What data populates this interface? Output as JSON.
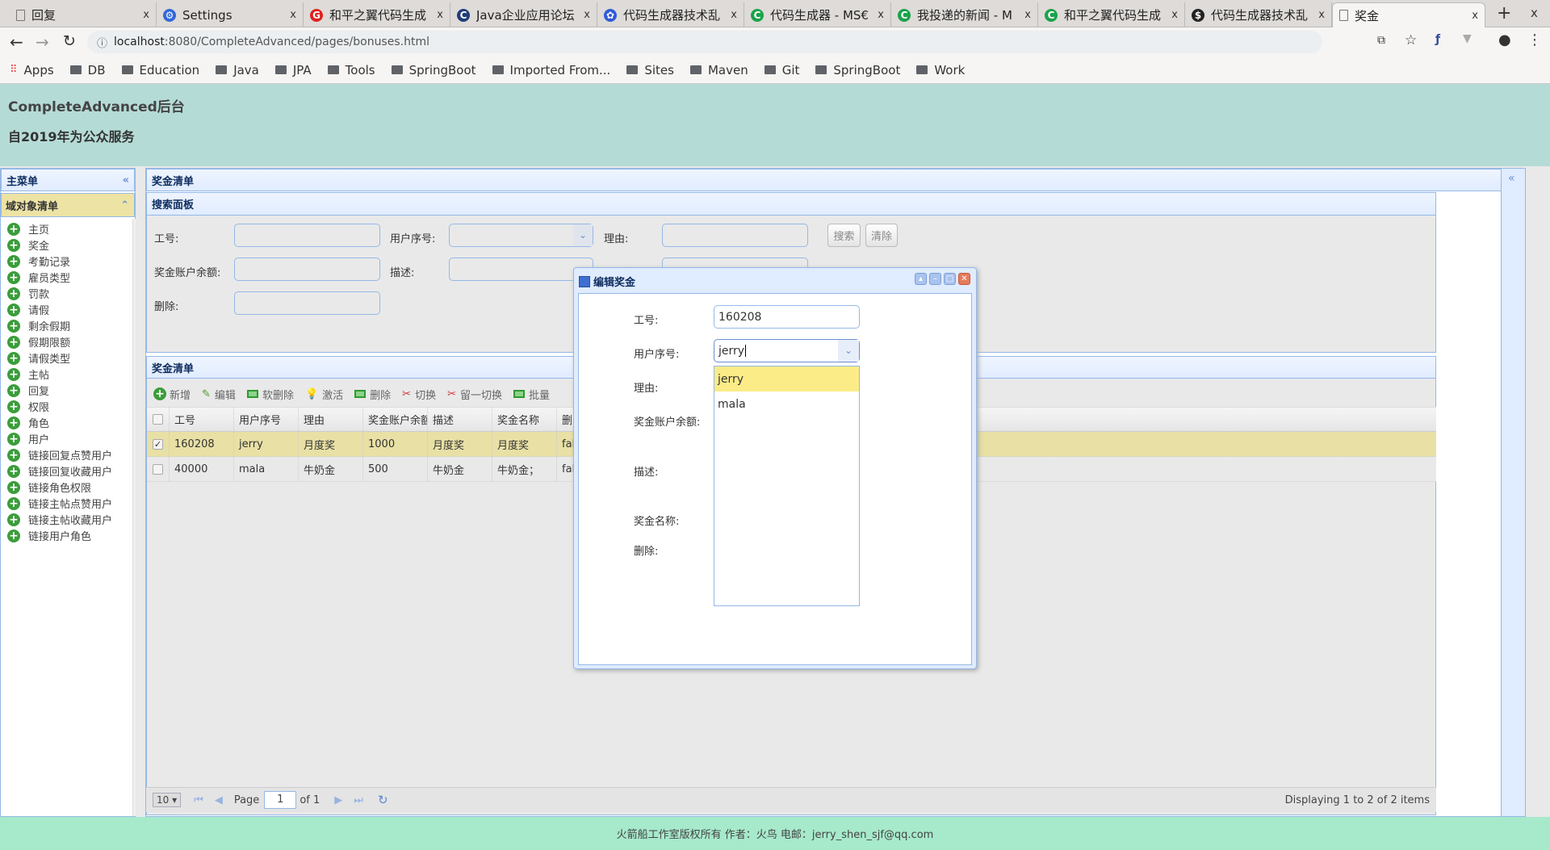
{
  "browser": {
    "tabs": [
      {
        "title": "回复",
        "icon": "page-icon",
        "color": "#555"
      },
      {
        "title": "Settings",
        "icon": "gear-icon",
        "color": "#3367d6"
      },
      {
        "title": "和平之翼代码生成",
        "icon": "g-icon",
        "color": "#e02020"
      },
      {
        "title": "Java企业应用论坛",
        "icon": "c-icon",
        "color": "#1e3d7a"
      },
      {
        "title": "代码生成器技术乱",
        "icon": "paw-icon",
        "color": "#2f5bd8"
      },
      {
        "title": "代码生成器 - MS€",
        "icon": "c-icon",
        "color": "#1aa34a"
      },
      {
        "title": "我投递的新闻 - M",
        "icon": "c-icon",
        "color": "#1aa34a"
      },
      {
        "title": "和平之翼代码生成",
        "icon": "c-icon",
        "color": "#1aa34a"
      },
      {
        "title": "代码生成器技术乱",
        "icon": "moneybag-icon",
        "color": "#222"
      },
      {
        "title": "奖金",
        "icon": "page-icon",
        "color": "#555"
      }
    ],
    "url_host": "localhost",
    "url_rest": ":8080/CompleteAdvanced/pages/bonuses.html",
    "bookmarks": [
      "Apps",
      "DB",
      "Education",
      "Java",
      "JPA",
      "Tools",
      "SpringBoot",
      "Imported From...",
      "Sites",
      "Maven",
      "Git",
      "SpringBoot",
      "Work"
    ]
  },
  "header": {
    "title": "CompleteAdvanced后台",
    "subtitle": "自2019年为公众服务"
  },
  "sidebar": {
    "title": "主菜单",
    "section": "域对象清单",
    "items": [
      "主页",
      "奖金",
      "考勤记录",
      "雇员类型",
      "罚款",
      "请假",
      "剩余假期",
      "假期限额",
      "请假类型",
      "主帖",
      "回复",
      "权限",
      "角色",
      "用户",
      "链接回复点赞用户",
      "链接回复收藏用户",
      "链接角色权限",
      "链接主帖点赞用户",
      "链接主帖收藏用户",
      "链接用户角色"
    ]
  },
  "main": {
    "title": "奖金清单",
    "search": {
      "title": "搜索面板",
      "fields": {
        "empid": "工号:",
        "userid": "用户序号:",
        "reason": "理由:",
        "balance": "奖金账户余额:",
        "desc": "描述:",
        "name": "奖金名称:",
        "deleted": "删除:"
      },
      "search_btn": "搜索",
      "clear_btn": "清除"
    },
    "grid": {
      "title": "奖金清单",
      "toolbar": [
        "新增",
        "编辑",
        "软删除",
        "激活",
        "删除",
        "切换",
        "留一切换",
        "批量"
      ],
      "columns": [
        "工号",
        "用户序号",
        "理由",
        "奖金账户余额",
        "描述",
        "奖金名称",
        "删除"
      ],
      "rows": [
        {
          "checked": true,
          "cells": [
            "160208",
            "jerry",
            "月度奖",
            "1000",
            "月度奖",
            "月度奖",
            "false"
          ]
        },
        {
          "checked": false,
          "cells": [
            "40000",
            "mala",
            "牛奶金",
            "500",
            "牛奶金",
            "牛奶金；",
            "false"
          ]
        }
      ],
      "pager": {
        "page_size": "10",
        "page_label": "Page",
        "page": "1",
        "of": "of 1",
        "display": "Displaying 1 to 2 of 2 items"
      }
    }
  },
  "dialog": {
    "title": "编辑奖金",
    "labels": {
      "empid": "工号:",
      "userid": "用户序号:",
      "reason": "理由:",
      "balance": "奖金账户余额:",
      "desc": "描述:",
      "name": "奖金名称:",
      "deleted": "删除:"
    },
    "empid_value": "160208",
    "userid_value": "jerry",
    "options": [
      "jerry",
      "mala"
    ],
    "selected": "jerry"
  },
  "footer": "火箭船工作室版权所有 作者：火鸟 电邮：jerry_shen_sjf@qq.com",
  "colors": {
    "header": "#b5dbd6",
    "footer": "#a6e9cb",
    "selected_row": "#e8e0a5",
    "highlight": "#fbec88",
    "panel_border": "#95b8e7"
  }
}
